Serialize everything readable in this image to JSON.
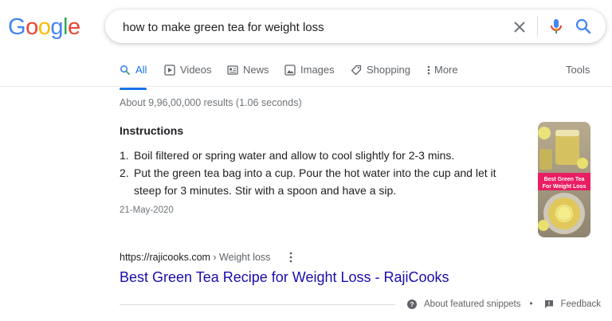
{
  "logo": {
    "text": "Google",
    "letters": [
      "G",
      "o",
      "o",
      "g",
      "l",
      "e"
    ],
    "colors": [
      "#4285f4",
      "#ea4335",
      "#fbbc05",
      "#4285f4",
      "#34a853",
      "#ea4335"
    ]
  },
  "search": {
    "query": "how to make green tea for weight loss",
    "clear_icon": "close-icon",
    "mic_icon": "mic-icon",
    "search_icon": "search-icon"
  },
  "tabs": [
    {
      "label": "All",
      "icon": "search-icon",
      "active": true
    },
    {
      "label": "Videos",
      "icon": "play-icon",
      "active": false
    },
    {
      "label": "News",
      "icon": "news-icon",
      "active": false
    },
    {
      "label": "Images",
      "icon": "image-icon",
      "active": false
    },
    {
      "label": "Shopping",
      "icon": "tag-icon",
      "active": false
    },
    {
      "label": "More",
      "icon": "more-vert-icon",
      "active": false
    }
  ],
  "tools_label": "Tools",
  "result_stats": "About 9,96,00,000 results (1.06 seconds)",
  "snippet": {
    "heading": "Instructions",
    "steps": [
      {
        "num": "1.",
        "text": "Boil filtered or spring water and allow to cool slightly for 2-3 mins."
      },
      {
        "num": "2.",
        "text": "Put the green tea bag into a cup. Pour the hot water into the cup and let it steep for 3 minutes. Stir with a spoon and have a sip."
      }
    ],
    "date": "21-May-2020",
    "thumbnail_caption": [
      "Best Green Tea",
      "For Weight Loss"
    ]
  },
  "source": {
    "domain": "https://rajicooks.com",
    "separator": " › ",
    "path": "Weight loss"
  },
  "result_title": "Best Green Tea Recipe for Weight Loss - RajiCooks",
  "footer": {
    "about_label": "About featured snippets",
    "bullet": "•",
    "feedback_label": "Feedback"
  },
  "colors": {
    "link": "#1a0dab",
    "accent": "#1a73e8",
    "muted": "#70757a",
    "thumb_banner": "#e91e63"
  }
}
